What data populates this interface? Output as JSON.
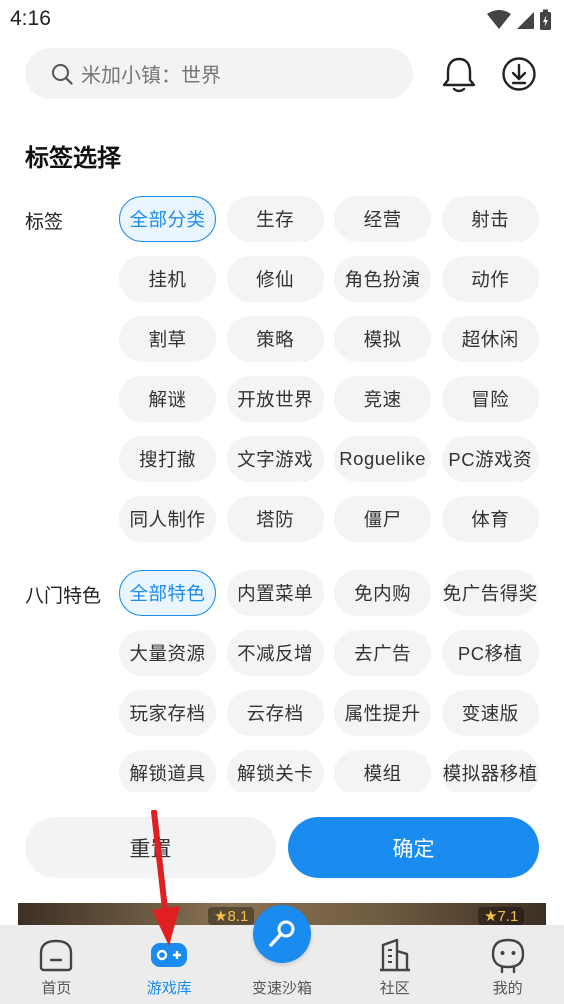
{
  "status": {
    "time": "4:16"
  },
  "search": {
    "placeholder": "米加小镇：世界"
  },
  "filter": {
    "title": "标签选择",
    "tag_group": {
      "label": "标签",
      "chips": [
        "全部分类",
        "生存",
        "经营",
        "射击",
        "挂机",
        "修仙",
        "角色扮演",
        "动作",
        "割草",
        "策略",
        "模拟",
        "超休闲",
        "解谜",
        "开放世界",
        "竞速",
        "冒险",
        "搜打撤",
        "文字游戏",
        "Roguelike",
        "PC游戏资",
        "同人制作",
        "塔防",
        "僵尸",
        "体育"
      ],
      "selected": "全部分类"
    },
    "feature_group": {
      "label": "八门特色",
      "chips": [
        "全部特色",
        "内置菜单",
        "免内购",
        "免广告得奖",
        "大量资源",
        "不减反增",
        "去广告",
        "PC移植",
        "玩家存档",
        "云存档",
        "属性提升",
        "变速版",
        "解锁道具",
        "解锁关卡",
        "模组",
        "模拟器移植"
      ],
      "selected": "全部特色"
    },
    "reset_label": "重置",
    "confirm_label": "确定"
  },
  "peek": {
    "rating_left": "★8.1",
    "rating_right": "★7.1"
  },
  "nav": [
    {
      "label": "首页",
      "icon": "home-icon"
    },
    {
      "label": "游戏库",
      "icon": "gamepad-icon"
    },
    {
      "label": "变速沙箱",
      "icon": "sandbox-key-icon"
    },
    {
      "label": "社区",
      "icon": "community-icon"
    },
    {
      "label": "我的",
      "icon": "profile-icon"
    }
  ],
  "colors": {
    "accent": "#1a8cf0",
    "chip_bg": "#f2f4f6",
    "annotation_arrow": "#e02020"
  }
}
